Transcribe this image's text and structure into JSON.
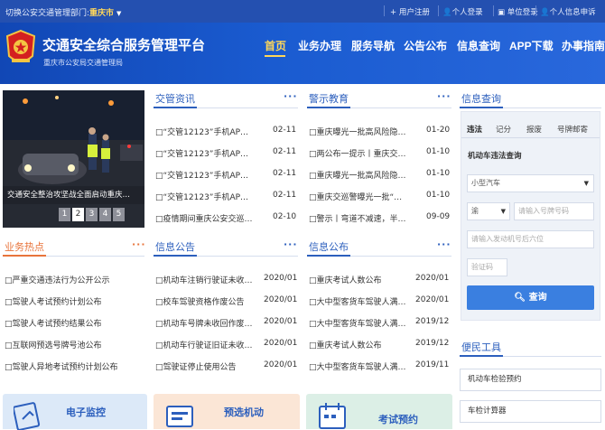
{
  "topbar": {
    "switch_prefix": "切换公安交通管理部门:",
    "current_dept": "重庆市",
    "links": [
      "用户注册",
      "个人登录",
      "单位登录",
      "个人信息申诉"
    ]
  },
  "header": {
    "title": "交通安全综合服务管理平台",
    "subtitle": "重庆市公安局交通管理局",
    "nav": [
      "首页",
      "业务办理",
      "服务导航",
      "公告公布",
      "信息查询",
      "APP下载",
      "办事指南"
    ]
  },
  "carousel": {
    "caption": "交通安全整治攻坚战全面启动重庆…",
    "pages": [
      "1",
      "2",
      "3",
      "4",
      "5"
    ],
    "active_page": 2
  },
  "sections": {
    "traffic_news": {
      "title": "交管资讯",
      "more": "···",
      "items": [
        {
          "title": "“交管12123”手机AP…",
          "date": "02-11"
        },
        {
          "title": "“交管12123”手机AP…",
          "date": "02-11"
        },
        {
          "title": "“交管12123”手机AP…",
          "date": "02-11"
        },
        {
          "title": "“交管12123”手机AP…",
          "date": "02-11"
        },
        {
          "title": "疫情期间重庆公安交巡…",
          "date": "02-10"
        }
      ]
    },
    "warning_edu": {
      "title": "警示教育",
      "more": "···",
      "items": [
        {
          "title": "重庆曝光一批高风险隐…",
          "date": "01-20"
        },
        {
          "title": "两公布一提示丨重庆交…",
          "date": "01-10"
        },
        {
          "title": "重庆曝光一批高风险隐…",
          "date": "01-10"
        },
        {
          "title": "重庆交巡警曝光一批“…",
          "date": "01-10"
        },
        {
          "title": "警示丨弯道不减速，半…",
          "date": "09-09"
        }
      ]
    },
    "hot_topics": {
      "title": "业务热点",
      "more": "···",
      "items": [
        "严重交通违法行为公开公示",
        "驾驶人考试预约计划公布",
        "驾驶人考试预约结果公布",
        "互联网预选号牌号池公布",
        "驾驶人异地考试预约计划公布"
      ]
    },
    "info_notice": {
      "title": "信息公告",
      "more": "···",
      "items": [
        {
          "title": "机动车注销行驶证未收…",
          "date": "2020/01"
        },
        {
          "title": "校车驾驶资格作废公告",
          "date": "2020/01"
        },
        {
          "title": "机动车号牌未收回作废…",
          "date": "2020/01"
        },
        {
          "title": "机动车行驶证旧证未收…",
          "date": "2020/01"
        },
        {
          "title": "驾驶证停止使用公告",
          "date": "2020/01"
        }
      ]
    },
    "info_publish": {
      "title": "信息公布",
      "more": "···",
      "items": [
        {
          "title": "重庆考试人数公布",
          "date": "2020/01"
        },
        {
          "title": "大中型客货车驾驶人满…",
          "date": "2020/01"
        },
        {
          "title": "大中型客货车驾驶人满…",
          "date": "2019/12"
        },
        {
          "title": "重庆考试人数公布",
          "date": "2019/12"
        },
        {
          "title": "大中型客货车驾驶人满…",
          "date": "2019/11"
        }
      ]
    }
  },
  "query": {
    "title": "信息查询",
    "tabs": [
      "违法",
      "记分",
      "报废",
      "号牌邮寄"
    ],
    "active_tab": 0,
    "subtitle": "机动车违法查询",
    "vehicle_type": "小型汽车",
    "plate_prefix": "渝",
    "plate_placeholder": "请输入号牌号码",
    "engine_placeholder": "请输入发动机号后六位",
    "captcha_placeholder": "验证码",
    "button": "查询"
  },
  "tools": {
    "title": "便民工具",
    "items": [
      "机动车检验预约",
      "车检计算器"
    ]
  },
  "bottom_cards": [
    {
      "label": "电子监控",
      "color": "#dce9f8",
      "text_color": "#2c5fbd"
    },
    {
      "label": "预选机动",
      "color": "#fbe6d6",
      "text_color": "#2c5fbd"
    },
    {
      "label": "考试预约",
      "color": "#dcefe6",
      "text_color": "#2c5fbd"
    }
  ],
  "colors": {
    "topbar": "#2450b0",
    "header": "#1a5bd0",
    "accent": "#2c5fbd",
    "orange": "#e8743b",
    "nav_active": "#ffd75a",
    "button": "#3a7fe0"
  }
}
